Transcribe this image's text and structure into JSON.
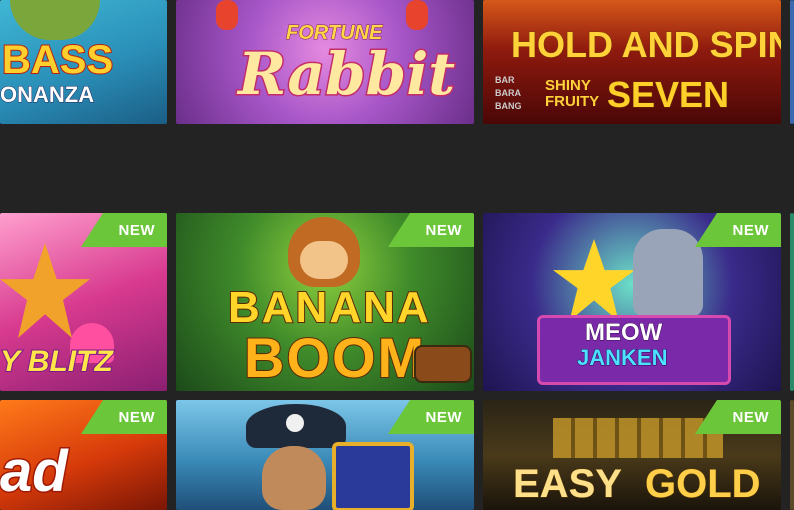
{
  "tiles": {
    "big_bass": {
      "line1": "BASS",
      "line2": "ONANZA"
    },
    "fortune_rabbit": {
      "line1": "FORTUNE",
      "line2": "Rabbit"
    },
    "hold_and_spin": {
      "line1": "HOLD AND SPIN",
      "brand": [
        "BAR",
        "BARA",
        "BANG"
      ],
      "sub1": "SHINY",
      "sub2": "FRUITY",
      "sub3": "SEVEN"
    },
    "candy_blitz": {
      "line1": "Y BLITZ",
      "badge": "NEW"
    },
    "banana_boom": {
      "line1": "BANANA",
      "line2": "BOOM",
      "badge": "NEW"
    },
    "meow_janken": {
      "line1": "MEOW",
      "line2": "JANKEN",
      "badge": "NEW"
    },
    "fire_game": {
      "line1": "ad",
      "badge": "NEW"
    },
    "pirate": {
      "badge": "NEW"
    },
    "easy_gold": {
      "line1": "EASY",
      "line2": "GOLD",
      "badge": "NEW"
    }
  },
  "colors": {
    "badge": "#6cc63a",
    "background": "#232323"
  }
}
